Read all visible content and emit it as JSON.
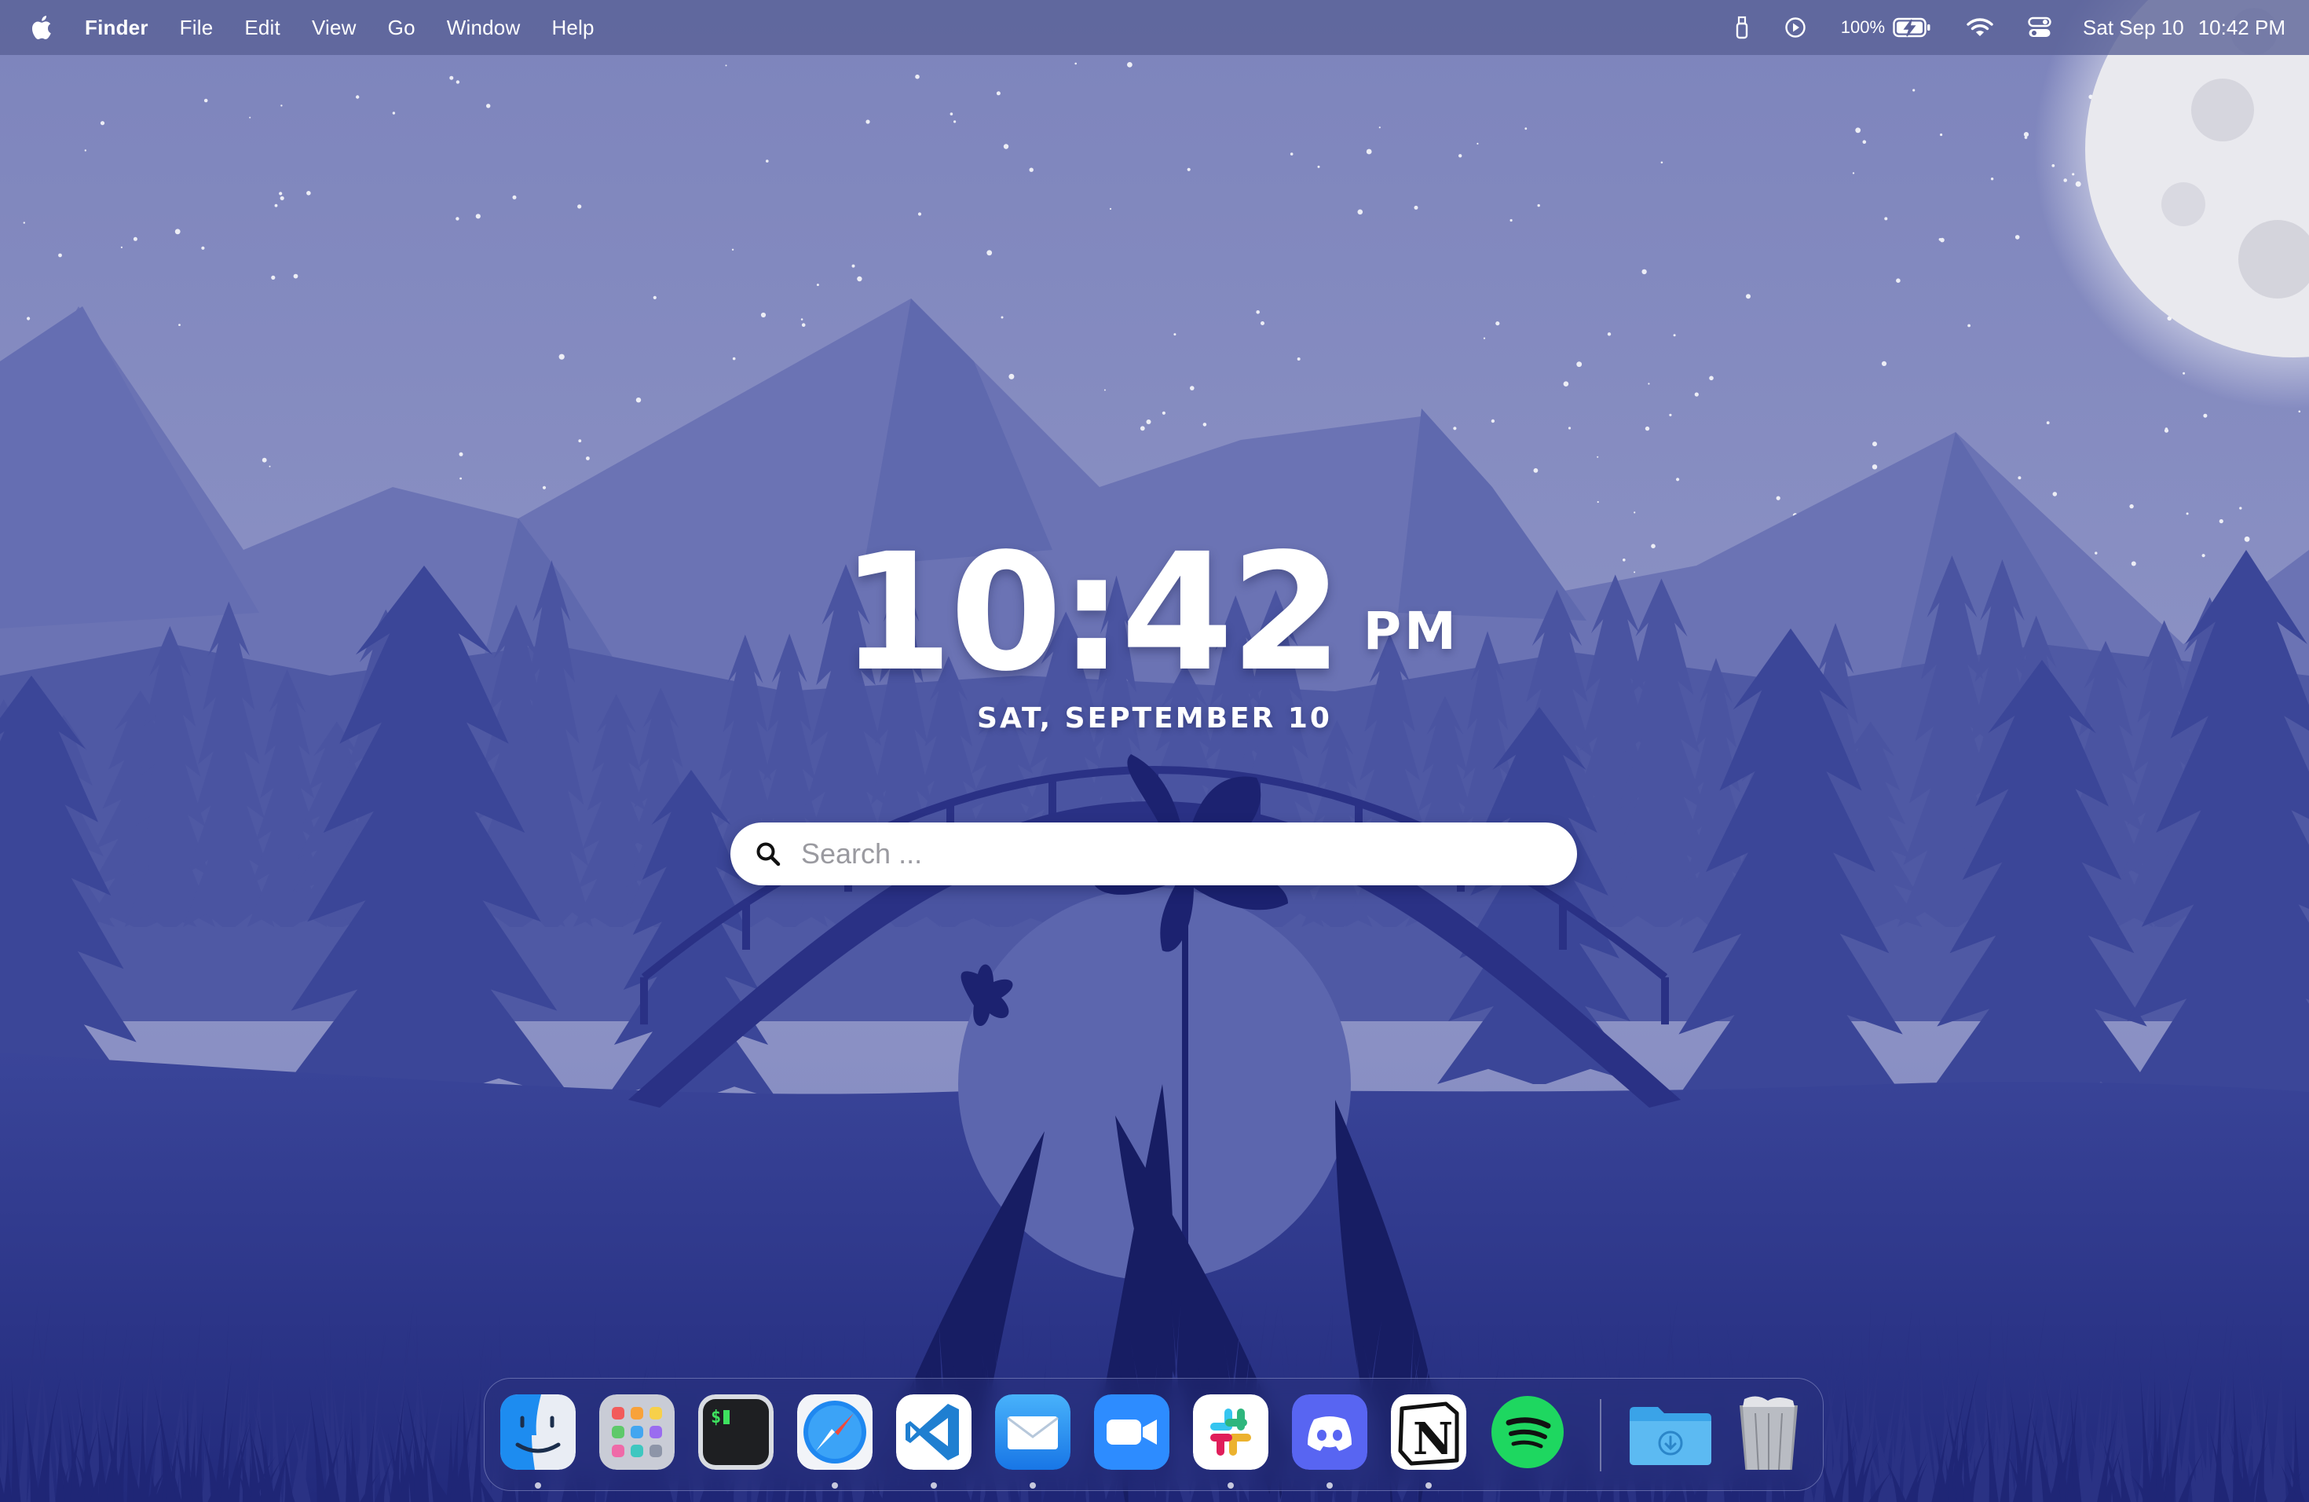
{
  "menubar": {
    "apple_icon": "apple-logo-icon",
    "app_name": "Finder",
    "menus": [
      "File",
      "Edit",
      "View",
      "Go",
      "Window",
      "Help"
    ],
    "status_icons": [
      "usb-device-icon",
      "play-circle-icon"
    ],
    "battery_percent": "100%",
    "battery_icon": "battery-charging-icon",
    "wifi_icon": "wifi-icon",
    "control_center_icon": "control-center-icon",
    "clock_date": "Sat Sep 10",
    "clock_time": "10:42 PM"
  },
  "widget": {
    "time": "10:42",
    "ampm": "PM",
    "date": "SAT, SEPTEMBER 10"
  },
  "search": {
    "placeholder": "Search ...",
    "value": ""
  },
  "dock": {
    "apps": [
      {
        "name": "Finder",
        "icon": "finder-icon",
        "running": true
      },
      {
        "name": "Launchpad",
        "icon": "launchpad-icon",
        "running": false
      },
      {
        "name": "Terminal",
        "icon": "terminal-icon",
        "running": false
      },
      {
        "name": "Safari",
        "icon": "safari-icon",
        "running": true
      },
      {
        "name": "Visual Studio Code",
        "icon": "vscode-icon",
        "running": true
      },
      {
        "name": "Mail",
        "icon": "mail-icon",
        "running": true
      },
      {
        "name": "Zoom",
        "icon": "zoom-icon",
        "running": false
      },
      {
        "name": "Slack",
        "icon": "slack-icon",
        "running": true
      },
      {
        "name": "Discord",
        "icon": "discord-icon",
        "running": true
      },
      {
        "name": "Notion",
        "icon": "notion-icon",
        "running": true
      },
      {
        "name": "Spotify",
        "icon": "spotify-icon",
        "running": false
      }
    ],
    "others": [
      {
        "name": "Downloads",
        "icon": "downloads-folder-icon"
      },
      {
        "name": "Trash",
        "icon": "trash-icon"
      }
    ]
  },
  "colors": {
    "sky_top": "#7f86bd",
    "mountains_far": "#6d75b6",
    "trees": "#3a4596",
    "ground": "#2b338a",
    "foreground": "#1b2168",
    "accent_white": "#ffffff"
  }
}
